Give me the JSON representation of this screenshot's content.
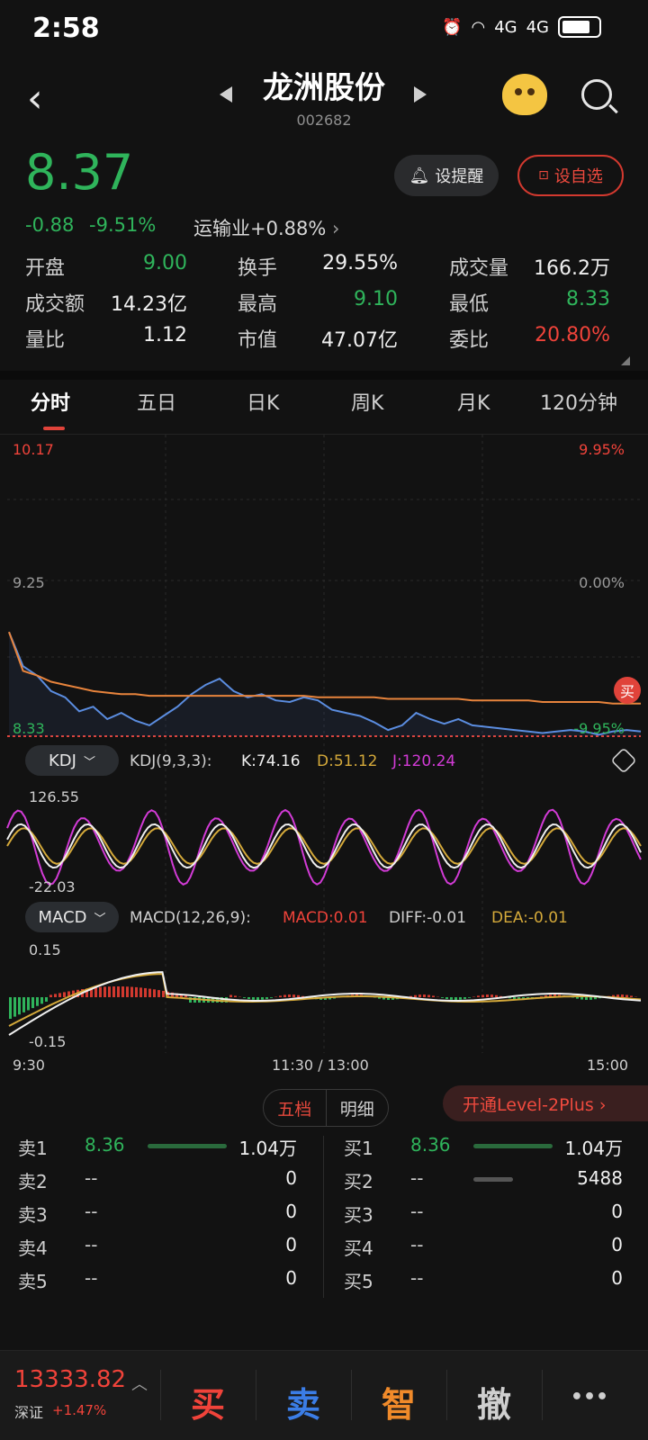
{
  "status_bar": {
    "time": "2:58",
    "net1": "4G",
    "net2": "4G"
  },
  "header": {
    "title": "龙洲股份",
    "code": "002682"
  },
  "quote": {
    "price": "8.37",
    "change": "-0.88",
    "change_pct": "-9.51%",
    "industry": "运输业+0.88%",
    "alert_label": "设提醒",
    "fav_label": "设自选",
    "stats": [
      {
        "label": "开盘",
        "value": "9.00",
        "color": "#2fb45b"
      },
      {
        "label": "换手",
        "value": "29.55%",
        "color": "#f0f0f0"
      },
      {
        "label": "成交量",
        "value": "166.2万",
        "color": "#f0f0f0"
      },
      {
        "label": "成交额",
        "value": "14.23亿",
        "color": "#f0f0f0"
      },
      {
        "label": "最高",
        "value": "9.10",
        "color": "#2fb45b"
      },
      {
        "label": "最低",
        "value": "8.33",
        "color": "#2fb45b"
      },
      {
        "label": "量比",
        "value": "1.12",
        "color": "#f0f0f0"
      },
      {
        "label": "市值",
        "value": "47.07亿",
        "color": "#f0f0f0"
      },
      {
        "label": "委比",
        "value": "20.80%",
        "color": "#f0433a"
      }
    ]
  },
  "tabs": [
    "分时",
    "五日",
    "日K",
    "周K",
    "月K",
    "120分钟"
  ],
  "chart": {
    "price_high": "10.17",
    "price_high_pct": "9.95%",
    "price_mid": "9.25",
    "price_mid_pct": "0.00%",
    "price_low": "8.33",
    "price_low_pct": "-9.95%",
    "buy_badge": "买",
    "time_labels": [
      "9:30",
      "11:30 / 13:00",
      "15:00"
    ]
  },
  "chart_data": {
    "type": "line",
    "title": "",
    "ylim": [
      8.33,
      10.17
    ],
    "xlabel": "",
    "ylabel": "",
    "series": [
      {
        "name": "",
        "color": "#5b8de0",
        "values": [
          9.0,
          8.78,
          8.72,
          8.62,
          8.58,
          8.49,
          8.52,
          8.44,
          8.48,
          8.43,
          8.4,
          8.46,
          8.52,
          8.6,
          8.66,
          8.7,
          8.62,
          8.58,
          8.6,
          8.56,
          8.55,
          8.58,
          8.56,
          8.5,
          8.48,
          8.46,
          8.42,
          8.37,
          8.4,
          8.48,
          8.44,
          8.41,
          8.44,
          8.4,
          8.39,
          8.38,
          8.37,
          8.36,
          8.35,
          8.36,
          8.37,
          8.36,
          8.34,
          8.36,
          8.37,
          8.36
        ]
      },
      {
        "name": "",
        "color": "#e8843c",
        "values": [
          9.0,
          8.75,
          8.72,
          8.68,
          8.66,
          8.64,
          8.62,
          8.61,
          8.6,
          8.6,
          8.59,
          8.59,
          8.59,
          8.59,
          8.59,
          8.59,
          8.59,
          8.59,
          8.59,
          8.59,
          8.59,
          8.59,
          8.58,
          8.58,
          8.58,
          8.58,
          8.58,
          8.57,
          8.57,
          8.57,
          8.57,
          8.57,
          8.57,
          8.56,
          8.56,
          8.56,
          8.56,
          8.56,
          8.55,
          8.55,
          8.55,
          8.55,
          8.55,
          8.54,
          8.54,
          8.54
        ]
      }
    ]
  },
  "kdj": {
    "pill": "KDJ",
    "params": "KDJ(9,3,3):",
    "k": "K:74.16",
    "d": "D:51.12",
    "j": "J:120.24",
    "top": "126.55",
    "bottom": "-22.03"
  },
  "macd": {
    "pill": "MACD",
    "params": "MACD(12,26,9):",
    "macd": "MACD:0.01",
    "diff": "DIFF:-0.01",
    "dea": "DEA:-0.01",
    "top": "0.15",
    "bottom": "-0.15"
  },
  "orderbook": {
    "tab_active": "五档",
    "tab_other": "明细",
    "level2": "开通Level-2Plus ›",
    "sell": [
      {
        "label": "卖1",
        "price": "8.36",
        "vol": "1.04万",
        "bar": 1.0
      },
      {
        "label": "卖2",
        "price": "--",
        "vol": "0",
        "bar": 0
      },
      {
        "label": "卖3",
        "price": "--",
        "vol": "0",
        "bar": 0
      },
      {
        "label": "卖4",
        "price": "--",
        "vol": "0",
        "bar": 0
      },
      {
        "label": "卖5",
        "price": "--",
        "vol": "0",
        "bar": 0
      }
    ],
    "buy": [
      {
        "label": "买1",
        "price": "8.36",
        "vol": "1.04万",
        "bar": 1.0
      },
      {
        "label": "买2",
        "price": "--",
        "vol": "5488",
        "bar": 0.5
      },
      {
        "label": "买3",
        "price": "--",
        "vol": "0",
        "bar": 0
      },
      {
        "label": "买4",
        "price": "--",
        "vol": "0",
        "bar": 0
      },
      {
        "label": "买5",
        "price": "--",
        "vol": "0",
        "bar": 0
      }
    ]
  },
  "bottom": {
    "index_value": "13333.82",
    "index_name": "深证",
    "index_change": "+1.47%",
    "buy": "买",
    "sell": "卖",
    "smart": "智",
    "cancel": "撤",
    "more": "•••"
  }
}
